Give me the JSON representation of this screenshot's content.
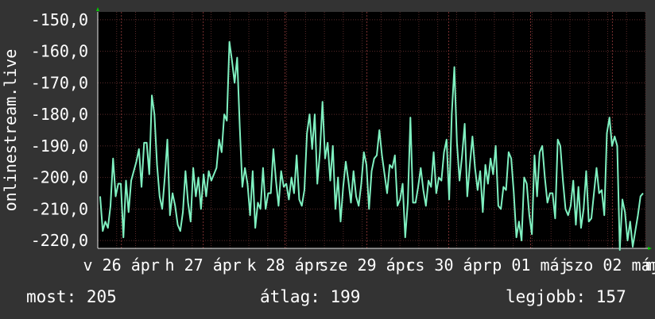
{
  "colors": {
    "background": "#333333",
    "plot_background": "#000000",
    "grid": "#5a2a2a",
    "axis": "#e8e8e8",
    "series": "#7ff0c0",
    "arrow": "#00cc00"
  },
  "stats": {
    "current": "most: 205",
    "average": "átlag: 199",
    "best": "legjobb: 157"
  },
  "chart_data": {
    "type": "line",
    "title": "",
    "xlabel": "",
    "ylabel": "onlinestream.live",
    "ylim": [
      -222.5,
      -147.5
    ],
    "yticks": [
      -150,
      -160,
      -170,
      -180,
      -190,
      -200,
      -210,
      -220
    ],
    "ytick_labels": [
      "-150,0",
      "-160,0",
      "-170,0",
      "-180,0",
      "-190,0",
      "-200,0",
      "-210,0",
      "-220,0"
    ],
    "xlim": [
      0,
      174
    ],
    "xticks": [
      {
        "label": "v 26 ápr",
        "x": 7.5
      },
      {
        "label": "h 27 ápr",
        "x": 33.5
      },
      {
        "label": "k 28 ápr",
        "x": 59.5
      },
      {
        "label": "sze 29 ápr",
        "x": 85.5
      },
      {
        "label": "cs 30 ápr",
        "x": 111.5
      },
      {
        "label": "p 01 máj",
        "x": 137.5
      },
      {
        "label": "szo 02 máj",
        "x": 163.5
      }
    ],
    "xtick_label_overflow": "m",
    "grid": true,
    "series": [
      {
        "values": [
          -206,
          -217,
          -214,
          -216,
          -209,
          -194,
          -206,
          -202,
          -202,
          -219,
          -201,
          -211,
          -201,
          -198,
          -195,
          -191,
          -203,
          -189,
          -189,
          -199,
          -174,
          -180,
          -196,
          -206,
          -210,
          -200,
          -188,
          -212,
          -205,
          -209,
          -215,
          -217,
          -211,
          -198,
          -208,
          -214,
          -197,
          -206,
          -200,
          -210,
          -199,
          -206,
          -198,
          -201,
          -199,
          -197,
          -188,
          -192,
          -180,
          -182,
          -157,
          -163,
          -170,
          -162,
          -184,
          -203,
          -197,
          -202,
          -212,
          -198,
          -216,
          -208,
          -210,
          -197,
          -210,
          -205,
          -205,
          -191,
          -201,
          -209,
          -198,
          -203,
          -202,
          -207,
          -200,
          -205,
          -193,
          -207,
          -209,
          -204,
          -186,
          -180,
          -191,
          -180,
          -202,
          -192,
          -176,
          -194,
          -189,
          -201,
          -190,
          -210,
          -200,
          -214,
          -203,
          -195,
          -201,
          -208,
          -198,
          -206,
          -209,
          -202,
          -192,
          -196,
          -210,
          -198,
          -194,
          -193,
          -185,
          -193,
          -199,
          -205,
          -196,
          -197,
          -193,
          -209,
          -207,
          -202,
          -219,
          -208,
          -181,
          -208,
          -208,
          -203,
          -197,
          -204,
          -209,
          -201,
          -203,
          -192,
          -205,
          -200,
          -201,
          -192,
          -188,
          -207,
          -180,
          -165,
          -189,
          -201,
          -193,
          -183,
          -206,
          -196,
          -187,
          -197,
          -204,
          -198,
          -211,
          -196,
          -202,
          -194,
          -199,
          -190,
          -209,
          -210,
          -203,
          -204,
          -192,
          -194,
          -205,
          -219,
          -214,
          -220,
          -200,
          -202,
          -212,
          -218,
          -193,
          -206,
          -192,
          -190,
          -200,
          -208,
          -205,
          -205,
          -213,
          -188,
          -190,
          -201,
          -210,
          -212,
          -209,
          -201,
          -215,
          -203,
          -216,
          -210,
          -198,
          -214,
          -213,
          -205,
          -197,
          -205,
          -204,
          -212,
          -186,
          -181,
          -190,
          -187,
          -190,
          -223,
          -207,
          -211,
          -220,
          -214,
          -222,
          -217,
          -212,
          -206,
          -205
        ]
      }
    ]
  }
}
